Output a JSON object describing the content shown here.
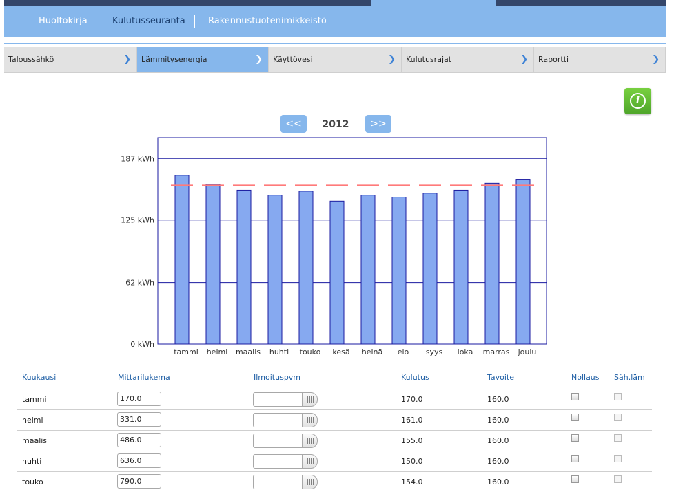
{
  "top_nav": {
    "items": [
      {
        "label": "Huoltokirja"
      },
      {
        "label": "Kulutusseuranta",
        "active": true
      },
      {
        "label": "Rakennustuotenimikkeistö"
      }
    ]
  },
  "tabs": [
    {
      "label": "Taloussähkö"
    },
    {
      "label": "Lämmitysenergia",
      "active": true
    },
    {
      "label": "Käyttövesi"
    },
    {
      "label": "Kulutusrajat"
    },
    {
      "label": "Raportti"
    }
  ],
  "year_nav": {
    "prev_label": "<<",
    "year": "2012",
    "next_label": ">>"
  },
  "colors": {
    "bar_fill": "#86a9f0",
    "bar_border": "#1a1aa0",
    "target_line": "#ff7a7a",
    "nav_blue": "#86b7ec"
  },
  "chart_data": {
    "type": "bar",
    "categories": [
      "tammi",
      "helmi",
      "maalis",
      "huhti",
      "touko",
      "kesä",
      "heinä",
      "elo",
      "syys",
      "loka",
      "marras",
      "joulu"
    ],
    "series": [
      {
        "values": [
          170,
          161,
          155,
          150,
          154,
          144,
          150,
          148,
          152,
          155,
          162,
          166
        ]
      },
      {
        "values": [
          160,
          160,
          160,
          160,
          160,
          160,
          160,
          160,
          160,
          160,
          160,
          160
        ]
      }
    ],
    "y_ticks": [
      "187 kWh",
      "125 kWh",
      "62 kWh",
      "0 kWh"
    ],
    "y_tick_values": [
      187,
      125,
      62,
      0
    ],
    "ylim": [
      0,
      208
    ],
    "grid": true
  },
  "table": {
    "headers": {
      "month": "Kuukausi",
      "meter": "Mittarilukema",
      "date": "Ilmoituspvm",
      "consumption": "Kulutus",
      "target": "Tavoite",
      "reset": "Nollaus",
      "elec": "Säh.läm"
    },
    "rows": [
      {
        "month": "tammi",
        "meter": "170.0",
        "consumption": "170.0",
        "target": "160.0"
      },
      {
        "month": "helmi",
        "meter": "331.0",
        "consumption": "161.0",
        "target": "160.0"
      },
      {
        "month": "maalis",
        "meter": "486.0",
        "consumption": "155.0",
        "target": "160.0"
      },
      {
        "month": "huhti",
        "meter": "636.0",
        "consumption": "150.0",
        "target": "160.0"
      },
      {
        "month": "touko",
        "meter": "790.0",
        "consumption": "154.0",
        "target": "160.0"
      }
    ]
  }
}
